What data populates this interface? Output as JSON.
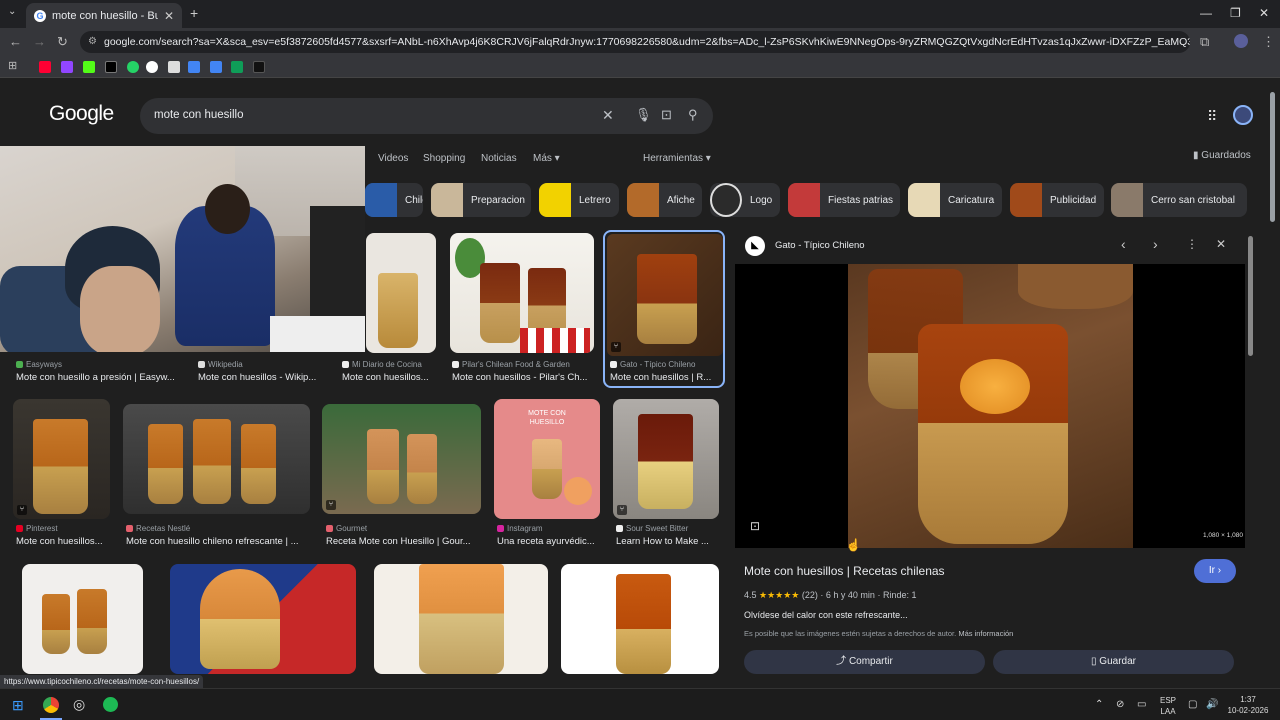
{
  "browser": {
    "tab_title": "mote con huesillo - Buscar con",
    "new_tab": "+",
    "url": "google.com/search?sa=X&sca_esv=e5f3872605fd4577&sxsrf=ANbL-n6XhAvp4j6K8CRJV6jFalqRdrJnyw:1770698226580&udm=2&fbs=ADc_l-ZsP6SKvhKiwE9NNegOps-9ryZRMQGZQtVxgdNcrEdHTvzas1qJxZwwr-iDXFZzP_EaMQ3UbwnzloH8GXTDJn_AV2vV..."
  },
  "google": {
    "logo": "Google",
    "query": "mote con huesillo",
    "nav": {
      "videos": "Videos",
      "shopping": "Shopping",
      "news": "Noticias",
      "more": "Más",
      "tools": "Herramientas",
      "saved": "Guardados"
    }
  },
  "chips": [
    {
      "label": "Chile",
      "color": "#2a5ca8"
    },
    {
      "label": "Preparacion",
      "color": "#c9b79a"
    },
    {
      "label": "Letrero",
      "color": "#f2d200"
    },
    {
      "label": "Afiche",
      "color": "#b36a2a"
    },
    {
      "label": "Logo",
      "color": "#2b2b2b"
    },
    {
      "label": "Fiestas patrias",
      "color": "#c33a3a"
    },
    {
      "label": "Caricatura",
      "color": "#e7d9b6"
    },
    {
      "label": "Publicidad",
      "color": "#a04a1a"
    },
    {
      "label": "Cerro san cristobal",
      "color": "#8a7a6a"
    }
  ],
  "results_row1": [
    {
      "source": "Easyways",
      "caption": "Mote con huesillo a presión | Easyw..."
    },
    {
      "source": "Wikipedia",
      "caption": "Mote con huesillos - Wikip..."
    },
    {
      "source": "Mi Diario de Cocina",
      "caption": "Mote con huesillos..."
    },
    {
      "source": "Pilar's Chilean Food & Garden",
      "caption": "Mote con huesillos - Pilar's Ch..."
    },
    {
      "source": "Gato - Típico Chileno",
      "caption": "Mote con huesillos | R..."
    }
  ],
  "results_row2": [
    {
      "source": "Pinterest",
      "caption": "Mote con huesillos..."
    },
    {
      "source": "Recetas Nestlé",
      "caption": "Mote con huesillo chileno refrescante | ..."
    },
    {
      "source": "Gourmet",
      "caption": "Receta Mote con Huesillo | Gour..."
    },
    {
      "source": "Instagram",
      "caption": "Una receta ayurvédic..."
    },
    {
      "source": "Sour Sweet Bitter",
      "caption": "Learn How to Make ..."
    }
  ],
  "instagram_img_text": "MOTE CON HUESILLO",
  "panel": {
    "site": "Gato - Típico Chileno",
    "dimensions": "1,080 × 1,080",
    "title": "Mote con huesillos | Recetas chilenas",
    "go_label": "Ir",
    "rating": "4.5",
    "stars": "★★★★★",
    "reviews": "(22)",
    "time": "6 h y 40 min",
    "yield": "Rinde: 1",
    "description": "Olvídese del calor con este refrescante...",
    "copyright": "Es posible que las imágenes estén sujetas a derechos de autor.",
    "more_info": "Más información",
    "share": "Compartir",
    "save": "Guardar"
  },
  "status_url": "https://www.tipicochileno.cl/recetas/mote-con-huesillos/",
  "taskbar": {
    "lang1": "ESP",
    "lang2": "LAA",
    "time": "1:37",
    "date": "10-02-2026"
  }
}
